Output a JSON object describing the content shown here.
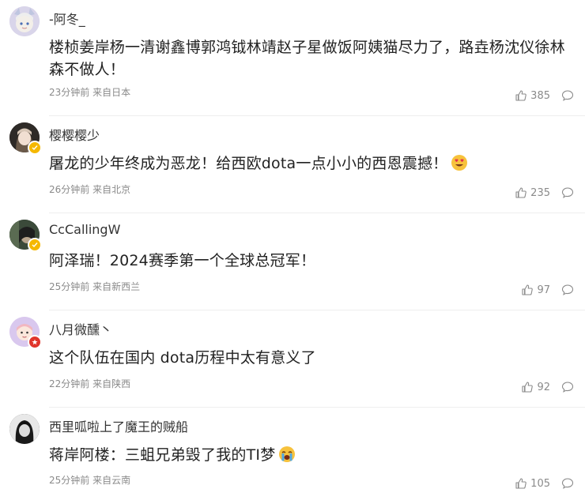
{
  "comments": [
    {
      "username": "-阿冬_",
      "text": "楼桢姜岸杨一清谢鑫博郭鸿钺林靖赵子星做饭阿姨猫尽力了，路垚杨沈仪徐林森不做人！",
      "time": "23分钟前",
      "location": "来自日本",
      "likes": "385",
      "badge": null,
      "avatar_color": "#c9c4da"
    },
    {
      "username": "樱樱樱少",
      "text": "屠龙的少年终成为恶龙！给西欧dota一点小小的西恩震撼！",
      "emoji": "heart-eyes-face-emoji",
      "time": "26分钟前",
      "location": "来自北京",
      "likes": "235",
      "badge": "verified-yellow",
      "avatar_color": "#3a3530"
    },
    {
      "username": "CcCallingW",
      "text": "阿泽瑞！2024赛季第一个全球总冠军！",
      "time": "25分钟前",
      "location": "来自新西兰",
      "likes": "97",
      "badge": "verified-yellow",
      "avatar_color": "#2d3a2e"
    },
    {
      "username": "八月微醺丶",
      "text": "这个队伍在国内 dota历程中太有意义了",
      "time": "22分钟前",
      "location": "来自陕西",
      "likes": "92",
      "badge": "verified-red",
      "avatar_color": "#d7c9ea"
    },
    {
      "username": "西里呱啦上了魔王的贼船",
      "text": "蒋岸阿楼：三蛆兄弟毁了我的TI梦",
      "emoji": "crying-face-emoji",
      "time": "25分钟前",
      "location": "来自云南",
      "likes": "105",
      "badge": null,
      "avatar_color": "#2a2a2a"
    }
  ],
  "colors": {
    "meta": "#8a8a8a",
    "divider": "#eeeeee",
    "badge_yellow": "#f5b800",
    "badge_red": "#e0352b"
  }
}
